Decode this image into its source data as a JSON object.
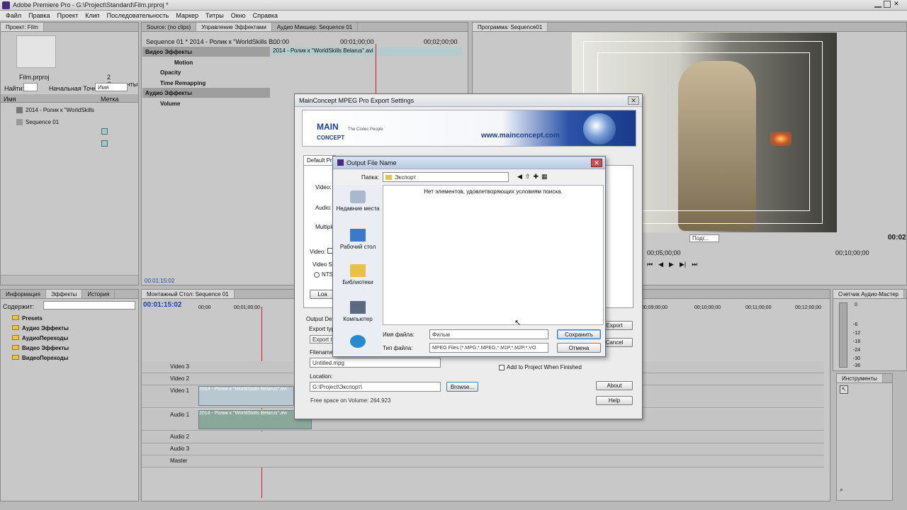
{
  "app": {
    "title": "Adobe Premiere Pro - G:\\Project\\Standard\\Film.prproj *"
  },
  "menu": [
    "Файл",
    "Правка",
    "Проект",
    "Клип",
    "Последовательность",
    "Маркер",
    "Титры",
    "Окно",
    "Справка"
  ],
  "project": {
    "tab": "Проект: Film",
    "file": "Film.prproj",
    "count": "2 Элементы",
    "find_label": "Найти:",
    "entry_label": "Начальная Точка:",
    "entry_value": "Имя",
    "col_name": "Имя",
    "col_label": "Метка",
    "items": [
      "2014 - Ролик к \"WorldSkills",
      "Sequence 01"
    ]
  },
  "effects_panel": {
    "tabs": [
      "Информация",
      "Эффекты",
      "История"
    ],
    "contains": "Содержит:",
    "folders": [
      "Presets",
      "Аудио Эффекты",
      "АудиоПереходы",
      "Видео Эффекты",
      "ВидеоПереходы"
    ]
  },
  "ecp": {
    "tabs": [
      "Source: (no clips)",
      "Управление Эффектами",
      "Аудио Микшер: Sequence 01"
    ],
    "seq": "Sequence 01 * 2014 - Ролик к \"WorldSkills B...",
    "t0": ":00:00",
    "t1": "00:01;00;00",
    "t2": "00;02;00;00",
    "clipname": "2014 - Ролик к \"WorldSkills Belarus\".avi",
    "video_fx": "Видео Эффекты",
    "motion": "Motion",
    "opacity": "Opacity",
    "timeremap": "Time Remapping",
    "audio_fx": "Аудио Эффекты",
    "volume": "Volume",
    "tc": "00:01:15:02"
  },
  "program": {
    "tab": "Программа: Sequence01",
    "fit": "Подг...",
    "tc": "00:02",
    "r1": "00;05;00;00",
    "r2": "00;10;00;00"
  },
  "timeline": {
    "tab": "Монтажный Стол: Sequence 01",
    "tc": "00:01:15:02",
    "rulers": [
      "00;00",
      "00;01;00;00",
      "00;09;00;00",
      "00;10;00;00",
      "00;11;00;00",
      "00;12;00;00"
    ],
    "tracks": [
      "Video 3",
      "Video 2",
      "Video 1",
      "Audio 1",
      "Audio 2",
      "Audio 3",
      "Master"
    ],
    "clip": "2014 - Ролик к \"WorldSkills Belarus\".avi"
  },
  "meter": {
    "tab": "Счетчик Аудио-Мастер",
    "db": [
      "0",
      "-6",
      "-12",
      "-18",
      "-24",
      "-30",
      "-36"
    ]
  },
  "tools": {
    "tab": "Инструменты"
  },
  "mc": {
    "title": "MainConcept MPEG Pro Export Settings",
    "url": "www.mainconcept.com",
    "logo1": "MAIN",
    "logo2": "CONCEPT",
    "slogan": "The Codec People",
    "tab": "Default Pr",
    "video": "Video:",
    "audio": "Audio:",
    "multiplex": "Multiple",
    "video_cb": "Video:",
    "videost": "Video St",
    "ntsc": "NTS",
    "load": "Loa",
    "output": "Output Det",
    "export_type": "Export typ",
    "export_to": "Export to",
    "filename_label": "Filename:",
    "filename": "Untitled.mpg",
    "location_label": "Location:",
    "location": "G:\\Project\\Экспорт\\",
    "browse": "Browse...",
    "free": "Free space on Volume: 264.923",
    "export": "Export",
    "cancel": "Cancel",
    "addproj": "Add to Project When Finished",
    "about": "About",
    "help": "Help"
  },
  "ofn": {
    "title": "Output File Name",
    "folder_label": "Папка:",
    "folder": "Экспорт",
    "empty": "Нет элементов, удовлетворяющих условиям поиска.",
    "places": [
      "Недавние места",
      "Рабочий стол",
      "Библиотеки",
      "Компьютер"
    ],
    "name_label": "Имя файла:",
    "name_value": "Фильм",
    "type_label": "Тип файла:",
    "type_value": "MPEG Files (*.MPG,*.MPEG,*.M1P,*.M2P,*.VO",
    "save": "Сохранить",
    "cancel": "Отмена"
  },
  "colors": {
    "blue_tc": "#1a44a8",
    "playhead": "#d02020",
    "clip": "#9fb6c4"
  }
}
